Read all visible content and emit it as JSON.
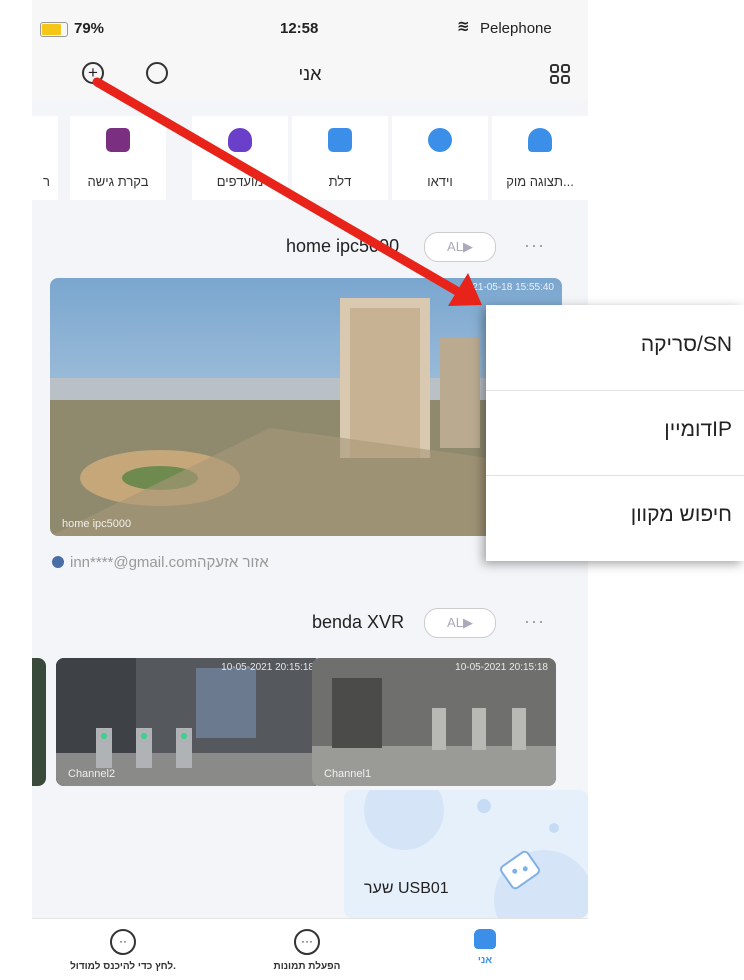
{
  "status_bar": {
    "battery": "79%",
    "time": "12:58",
    "carrier": "Pelephone"
  },
  "header": {
    "title": "אני",
    "add_icon": "plus-circle-icon",
    "search_icon": "search-icon",
    "grid_icon": "grid-icon"
  },
  "categories": [
    {
      "label": "תצוגה מוק...",
      "icon": "camera-icon",
      "color": "#3b8fe8"
    },
    {
      "label": "וידאו",
      "icon": "video-icon",
      "color": "#3b8fe8"
    },
    {
      "label": "דלת",
      "icon": "door-icon",
      "color": "#3b8fe8"
    },
    {
      "label": "מועדפים",
      "icon": "heart-icon",
      "color": "#6a3fc9"
    },
    {
      "label": "בקרת גישה",
      "icon": "access-control-icon",
      "color": "#7a2f80"
    },
    {
      "label": "ר",
      "icon": "",
      "color": "#cccccc"
    }
  ],
  "device1": {
    "name": "home ipc5000",
    "al_label": "AL▶",
    "more": "···",
    "timestamp": "2021-05-18 15:55:40",
    "channel": "home ipc5000",
    "account": "inn****@gmail.com",
    "zone": "אזור אזעקה"
  },
  "device2": {
    "name": "benda XVR",
    "al_label": "AL▶",
    "more": "···",
    "channels": [
      {
        "label": "Channel1",
        "timestamp": "10-05-2021 20:15:18"
      },
      {
        "label": "Channel2",
        "timestamp": "10-05-2021 20:15:18"
      }
    ],
    "gate": "שער USB01"
  },
  "bottom_nav": [
    {
      "label": "אני",
      "icon": "home-icon",
      "active": true
    },
    {
      "label": "הפעלת תמונות",
      "icon": "chat-icon",
      "active": false
    },
    {
      "label": "לחץ כדי להיכנס למודול.",
      "icon": "smile-icon",
      "active": false
    }
  ],
  "add_menu": [
    "סריקה/SN",
    "דומייןIP",
    "חיפוש מקוון"
  ],
  "colors": {
    "accent": "#3b8fe8",
    "arrow": "#e8231a"
  }
}
